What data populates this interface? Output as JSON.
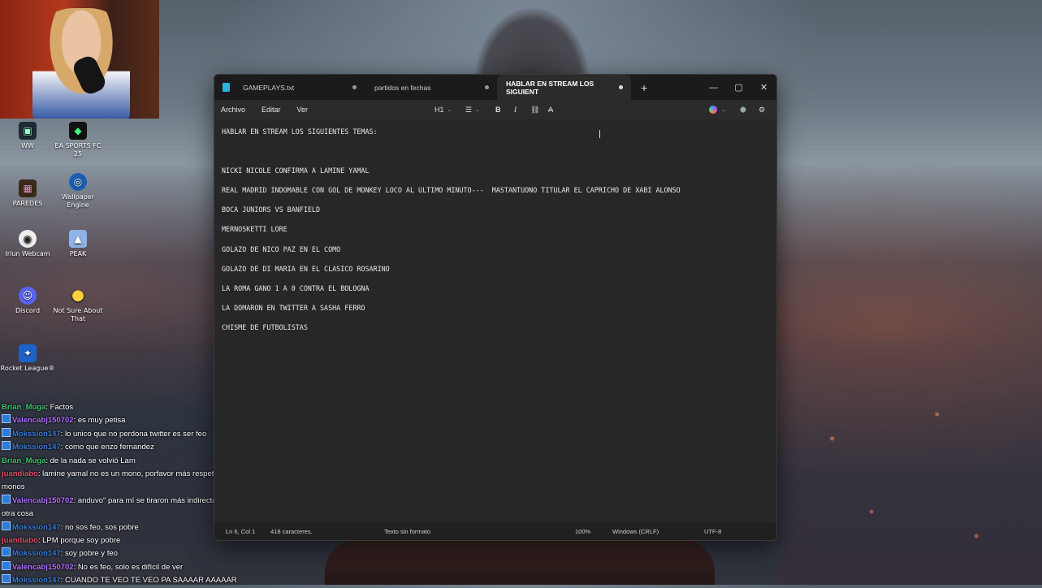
{
  "desktop": {
    "icons": [
      {
        "label": "WW",
        "name": "ww-icon"
      },
      {
        "label": "EA SPORTS FC 25",
        "name": "ea-sports-fc-icon"
      },
      {
        "label": "PAREDES",
        "name": "paredes-icon"
      },
      {
        "label": "Wallpaper Engine",
        "name": "wallpaper-engine-icon"
      },
      {
        "label": "Iriun Webcam",
        "name": "iriun-webcam-icon"
      },
      {
        "label": "PEAK",
        "name": "peak-icon"
      },
      {
        "label": "Discord",
        "name": "discord-icon"
      },
      {
        "label": "Not Sure About That",
        "name": "not-sure-about-that-icon"
      },
      {
        "label": "Rocket League®",
        "name": "rocket-league-icon"
      }
    ]
  },
  "chat": [
    {
      "user": "Brian_Muga",
      "text": ": Factos",
      "color": "#3cc36b",
      "badge": false
    },
    {
      "user": "Valencabj150702",
      "text": ": es muy petisa",
      "color": "#b46cff",
      "badge": true
    },
    {
      "user": "Mokssion147",
      "text": ": lo unico que no perdona twitter es ser feo",
      "color": "#3a7bd5",
      "badge": true
    },
    {
      "user": "Mokssion147",
      "text": ": como que enzo fernandez",
      "color": "#3a7bd5",
      "badge": true
    },
    {
      "user": "Brian_Muga",
      "text": ": de la nada se volvió Lam",
      "color": "#3cc36b",
      "badge": false
    },
    {
      "user": "juandiabo",
      "text": ": lamine yamal no es un mono, porfavor más respeto a los monos",
      "color": "#e0506a",
      "badge": false
    },
    {
      "user": "Valencabj150702",
      "text": ": anduvo\" para mí se tiraron más indirectas que otra cosa",
      "color": "#b46cff",
      "badge": true
    },
    {
      "user": "Mokssion147",
      "text": ": no sos feo, sos pobre",
      "color": "#3a7bd5",
      "badge": true
    },
    {
      "user": "juandiabo",
      "text": ": LPM porque soy pobre",
      "color": "#e0506a",
      "badge": false
    },
    {
      "user": "Mokssion147",
      "text": ": soy pobre y feo",
      "color": "#3a7bd5",
      "badge": true
    },
    {
      "user": "Valencabj150702",
      "text": ": No es feo, solo es difícil de ver",
      "color": "#b46cff",
      "badge": true
    },
    {
      "user": "Mokssion147",
      "text": ": CUANDO TE VEO TE VEO PA SAAAAR AAAAAR",
      "color": "#3a7bd5",
      "badge": true
    }
  ],
  "notepad": {
    "tabs": [
      {
        "label": "GAMEPLAYS.txt"
      },
      {
        "label": "partidos en fechas"
      },
      {
        "label": "HABLAR EN STREAM LOS SIGUIENT"
      }
    ],
    "new_tab": "+",
    "window_controls": {
      "minimize": "—",
      "maximize": "▢",
      "close": "✕"
    },
    "menu": {
      "file": "Archivo",
      "edit": "Editar",
      "view": "Ver"
    },
    "format": {
      "heading": "H1",
      "list": "☰",
      "bold": "B",
      "italic": "I",
      "link": "⛓",
      "clear": "A"
    },
    "lines": [
      "HABLAR EN STREAM LOS SIGUIENTES TEMAS:",
      "",
      "NICKI NICOLE CONFIRMA A LAMINE YAMAL",
      "REAL MADRID INDOMABLE CON GOL DE MONKEY LOCO AL ULTIMO MINUTO---  MASTANTUONO TITULAR EL CAPRICHO DE XABI ALONSO",
      "BOCA JUNIORS VS BANFIELD",
      "MERNOSKETTI LORE",
      "GOLAZO DE NICO PAZ EN EL COMO",
      "GOLAZO DE DI MARIA EN EL CLASICO ROSARINO",
      "LA ROMA GANO 1 A 0 CONTRA EL BOLOGNA",
      "LA DOMARON EN TWITTER A SASHA FERRO",
      "CHISME DE FUTBOLISTAS"
    ],
    "status": {
      "position": "Ln 6, Col 1",
      "chars": "418 caracteres.",
      "format": "Texto sin formato",
      "zoom": "100%",
      "line_ending": "Windows (CRLF)",
      "encoding": "UTF-8"
    }
  }
}
